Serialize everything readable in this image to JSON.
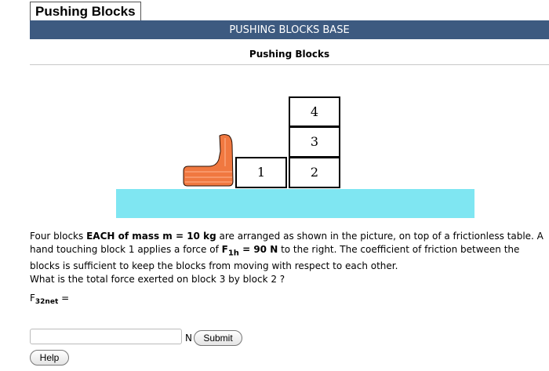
{
  "window": {
    "tab_title": "Pushing Blocks",
    "header_bar": "PUSHING BLOCKS BASE",
    "subtitle": "Pushing Blocks"
  },
  "figure": {
    "block_labels": [
      "1",
      "2",
      "3",
      "4"
    ],
    "colors": {
      "table": "#7fe6f2",
      "hand": "#f07840",
      "header_bar": "#3d5a80"
    },
    "icons": [
      "hand-icon"
    ]
  },
  "problem": {
    "p1_a": "Four blocks ",
    "p1_b": "EACH of mass m = 10 kg",
    "p1_c": " are arranged as shown in the picture, on top of a frictionless table. A hand touching block 1 applies a force of ",
    "p1_f": "F",
    "p1_sub": "1h",
    "p1_d": " = 90 N",
    "p1_e": " to the right. The coefficient of friction between the blocks is sufficient to keep the blocks from moving with respect to each other.",
    "question": "What is the total force exerted on block 3 by block 2 ?",
    "answer_label_main": "F",
    "answer_label_sub": "32net",
    "answer_label_tail": " ="
  },
  "controls": {
    "answer_value": "",
    "unit": "N",
    "submit_label": "Submit",
    "help_label": "Help"
  }
}
